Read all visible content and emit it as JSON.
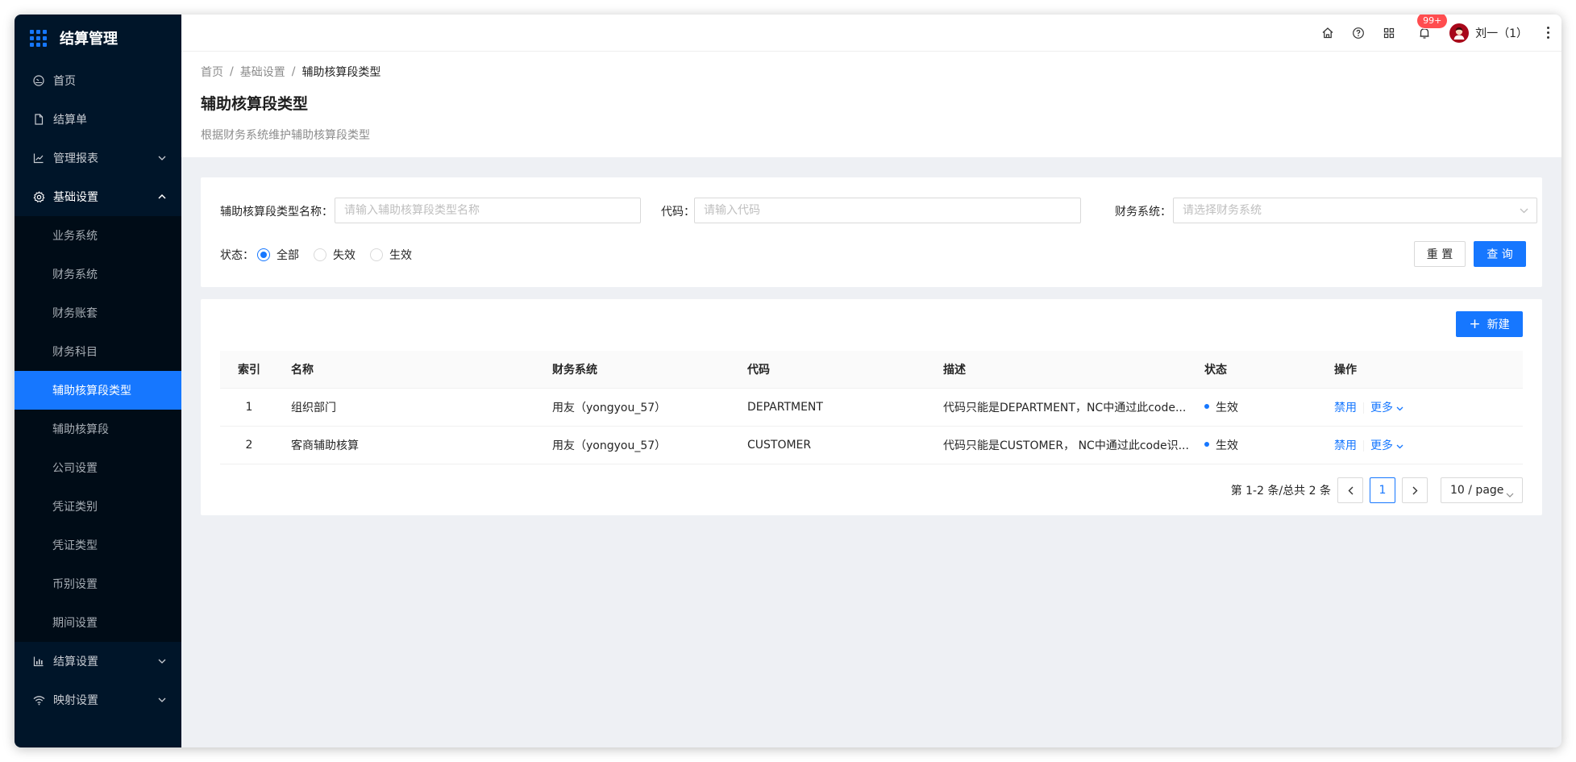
{
  "app": {
    "title": "结算管理"
  },
  "sidebar": {
    "items": [
      {
        "label": "首页",
        "icon": "dashboard-icon"
      },
      {
        "label": "结算单",
        "icon": "file-icon"
      },
      {
        "label": "管理报表",
        "icon": "line-chart-icon",
        "expandable": true
      },
      {
        "label": "基础设置",
        "icon": "setting-icon",
        "expandable": true,
        "open": true
      },
      {
        "label": "结算设置",
        "icon": "bar-chart-icon",
        "expandable": true
      },
      {
        "label": "映射设置",
        "icon": "wifi-icon",
        "expandable": true
      }
    ],
    "submenu": [
      {
        "label": "业务系统"
      },
      {
        "label": "财务系统"
      },
      {
        "label": "财务账套"
      },
      {
        "label": "财务科目"
      },
      {
        "label": "辅助核算段类型",
        "active": true
      },
      {
        "label": "辅助核算段"
      },
      {
        "label": "公司设置"
      },
      {
        "label": "凭证类别"
      },
      {
        "label": "凭证类型"
      },
      {
        "label": "币别设置"
      },
      {
        "label": "期间设置"
      }
    ]
  },
  "topbar": {
    "notification_badge": "99+",
    "user_name": "刘一（1）"
  },
  "breadcrumb": [
    "首页",
    "基础设置",
    "辅助核算段类型"
  ],
  "page": {
    "title": "辅助核算段类型",
    "description": "根据财务系统维护辅助核算段类型"
  },
  "filter": {
    "name_label": "辅助核算段类型名称：",
    "name_placeholder": "请输入辅助核算段类型名称",
    "code_label": "代码：",
    "code_placeholder": "请输入代码",
    "system_label": "财务系统：",
    "system_placeholder": "请选择财务系统",
    "status_label": "状态：",
    "status_options": [
      "全部",
      "失效",
      "生效"
    ],
    "status_selected": "全部",
    "reset_label": "重 置",
    "query_label": "查 询"
  },
  "table": {
    "new_button": "新建",
    "columns": [
      "索引",
      "名称",
      "财务系统",
      "代码",
      "描述",
      "状态",
      "操作"
    ],
    "rows": [
      {
        "index": "1",
        "name": "组织部门",
        "system": "用友（yongyou_57）",
        "code": "DEPARTMENT",
        "desc": "代码只能是DEPARTMENT，NC中通过此code...",
        "status": "生效",
        "action_disable": "禁用",
        "action_more": "更多"
      },
      {
        "index": "2",
        "name": "客商辅助核算",
        "system": "用友（yongyou_57）",
        "code": "CUSTOMER",
        "desc": "代码只能是CUSTOMER， NC中通过此code识...",
        "status": "生效",
        "action_disable": "禁用",
        "action_more": "更多"
      }
    ]
  },
  "pagination": {
    "summary": "第 1-2 条/总共 2 条",
    "current_page": "1",
    "page_size": "10 / page"
  },
  "colors": {
    "primary": "#1677ff",
    "sidebar_bg": "#001529",
    "badge": "#ff4d4f"
  }
}
